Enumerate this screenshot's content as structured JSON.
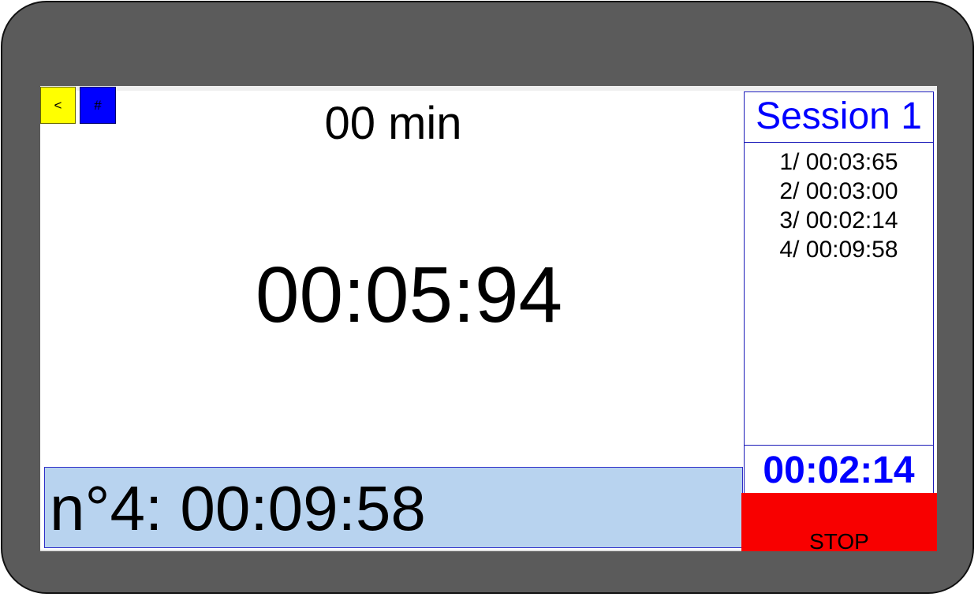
{
  "toolbar": {
    "back_label": "<",
    "hash_label": "#"
  },
  "timer": {
    "minutes": "00 min",
    "current": "00:05:94",
    "last_lap": "n°4: 00:09:58"
  },
  "session": {
    "title": "Session 1",
    "laps": [
      "1/ 00:03:65",
      "2/ 00:03:00",
      "3/ 00:02:14",
      "4/ 00:09:58"
    ],
    "best": "00:02:14"
  },
  "controls": {
    "stop_label": "STOP"
  },
  "colors": {
    "back_button": "#ffff00",
    "hash_button": "#0000ff",
    "stop_button": "#f80000",
    "accent_blue": "#0000ff",
    "last_lap_bg": "#b8d3ef",
    "device_frame": "#5b5b5b"
  }
}
